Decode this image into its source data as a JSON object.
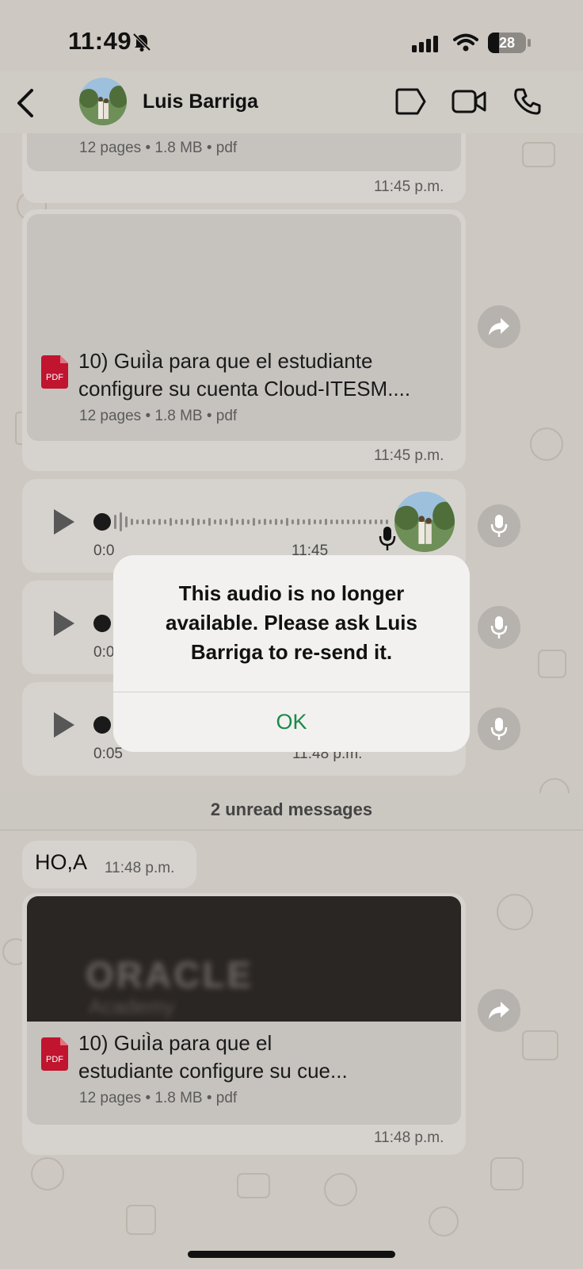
{
  "status": {
    "time": "11:49",
    "battery": "28"
  },
  "header": {
    "contact_name": "Luis Barriga"
  },
  "messages": {
    "doc1": {
      "meta": "12 pages • 1.8 MB • pdf",
      "time": "11:45 p.m."
    },
    "doc2": {
      "title_line1": "10) GuiÌa para que el estudiante",
      "title_line2": "configure su cuenta Cloud-ITESM....",
      "meta": "12 pages • 1.8 MB • pdf",
      "time": "11:45 p.m.",
      "icon_label": "PDF"
    },
    "audio1": {
      "duration": "0:0",
      "time": "11:45"
    },
    "audio2": {
      "duration": "0:0"
    },
    "audio3": {
      "duration": "0:05",
      "time": "11:48 p.m."
    },
    "unread_divider": "2 unread messages",
    "text1": {
      "text": "HO,A",
      "time": "11:48 p.m."
    },
    "doc3": {
      "preview_text": "ORACLE",
      "preview_subtext": "Academy",
      "title_line1": "10) GuiÌa para que el",
      "title_line2": "estudiante configure su cue...",
      "meta": "12 pages • 1.8 MB • pdf",
      "time": "11:48 p.m.",
      "icon_label": "PDF"
    }
  },
  "alert": {
    "message": "This audio is no longer available. Please ask Luis Barriga to re-send it.",
    "ok_label": "OK"
  },
  "colors": {
    "accent": "#1b8a48",
    "pdf_red": "#c0142f"
  }
}
